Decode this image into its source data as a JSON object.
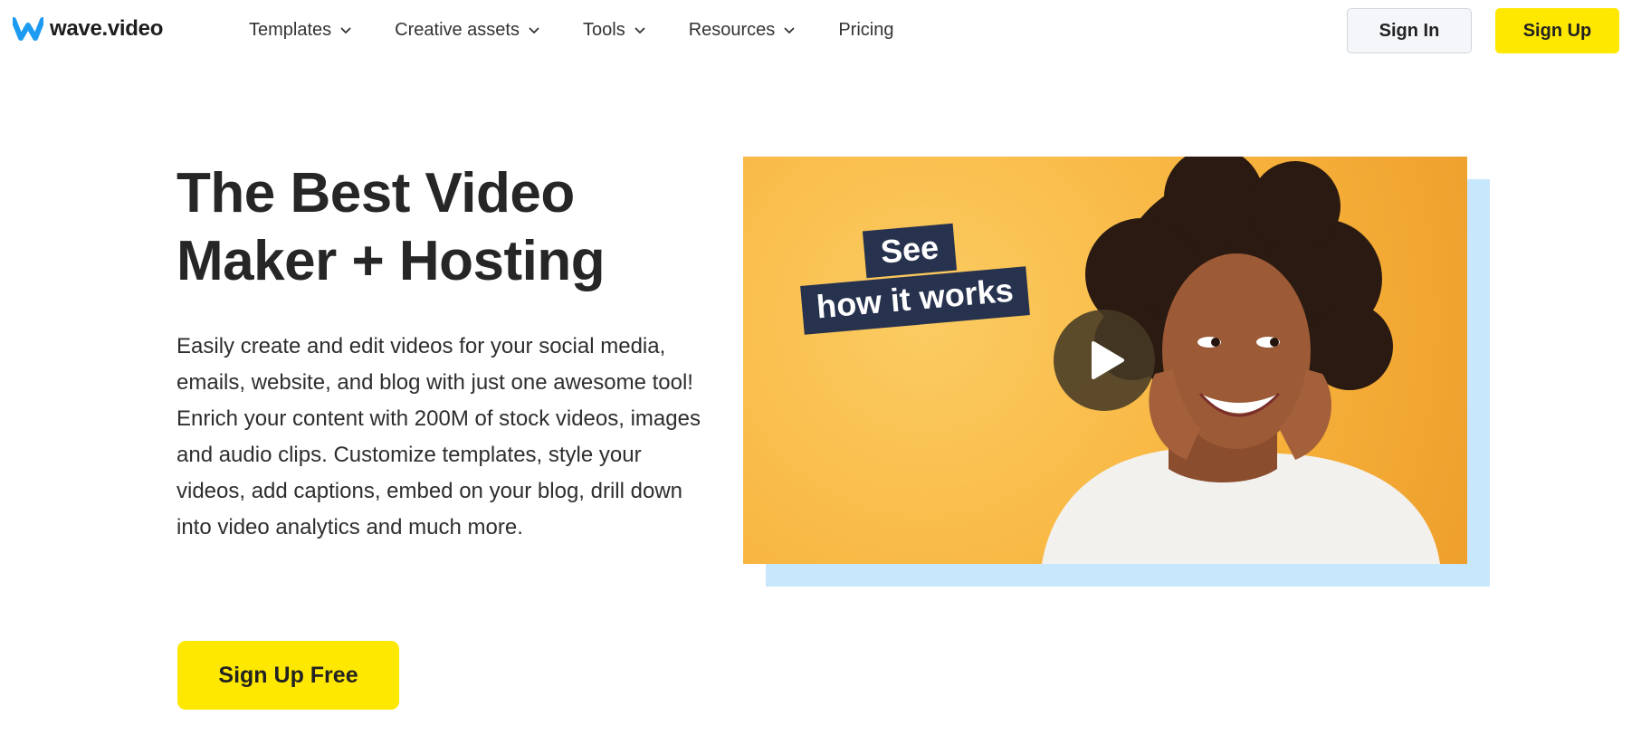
{
  "brand": {
    "logo_text": "wave.video",
    "logo_icon": "wave-w-logo-icon",
    "logo_color": "#1d9bf0"
  },
  "nav": {
    "items": [
      {
        "label": "Templates",
        "has_dropdown": true
      },
      {
        "label": "Creative assets",
        "has_dropdown": true
      },
      {
        "label": "Tools",
        "has_dropdown": true
      },
      {
        "label": "Resources",
        "has_dropdown": true
      },
      {
        "label": "Pricing",
        "has_dropdown": false
      }
    ]
  },
  "auth": {
    "sign_in_label": "Sign In",
    "sign_up_label": "Sign Up"
  },
  "hero": {
    "title_line1": "The Best Video",
    "title_line2": "Maker + Hosting",
    "description_1": "Easily create and edit videos for your social media, emails, website, and blog with just one awesome tool!",
    "description_2": "Enrich your content with 200M of stock videos, images and audio clips. Customize templates, style your videos, add captions, embed on your blog, drill down into video analytics and much more.",
    "cta_label": "Sign Up Free"
  },
  "video": {
    "tag_line1": "See",
    "tag_line2": "how it works",
    "play_icon": "play-icon"
  },
  "colors": {
    "accent_yellow": "#ffe800",
    "video_orange": "#f8b43e",
    "video_shadow_blue": "#c7e8fc",
    "tag_navy": "#27324f"
  }
}
